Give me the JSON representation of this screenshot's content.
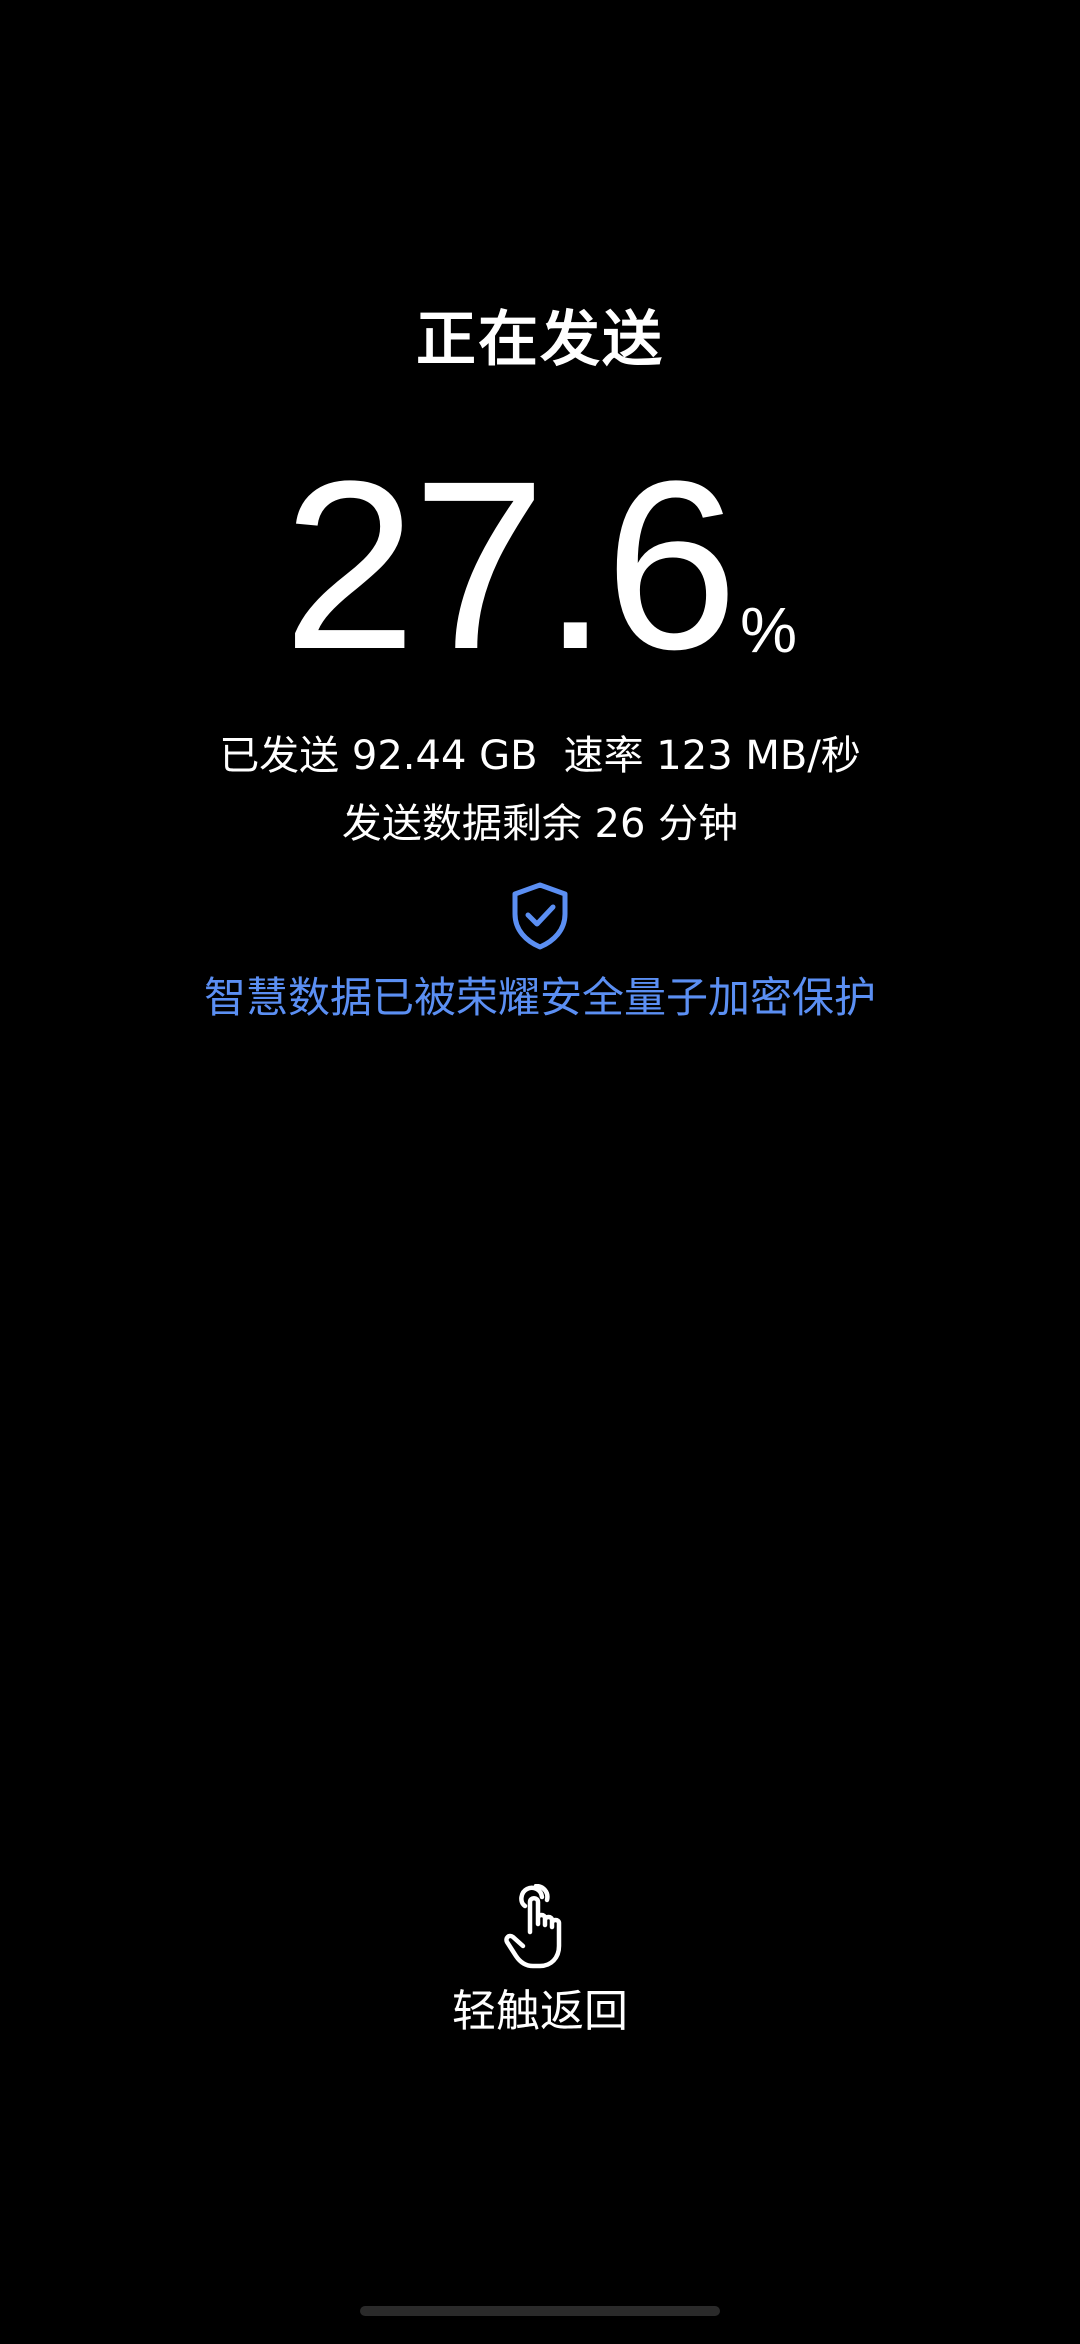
{
  "screen": {
    "title": "正在发送",
    "progress": {
      "value": "27.6",
      "unit": "%",
      "fraction": 0.276
    },
    "stats": {
      "sent_label": "已发送",
      "sent_value": "92.44 GB",
      "rate_label": "速率",
      "rate_value": "123 MB/秒"
    },
    "remaining": "发送数据剩余 26 分钟",
    "security_message": "智慧数据已被荣耀安全量子加密保护",
    "back_label": "轻触返回"
  },
  "icons": {
    "shield": "shield-check-icon",
    "touch": "hand-tap-icon"
  },
  "colors": {
    "background": "#000000",
    "text": "#ffffff",
    "accent": "#5b8ff3"
  }
}
